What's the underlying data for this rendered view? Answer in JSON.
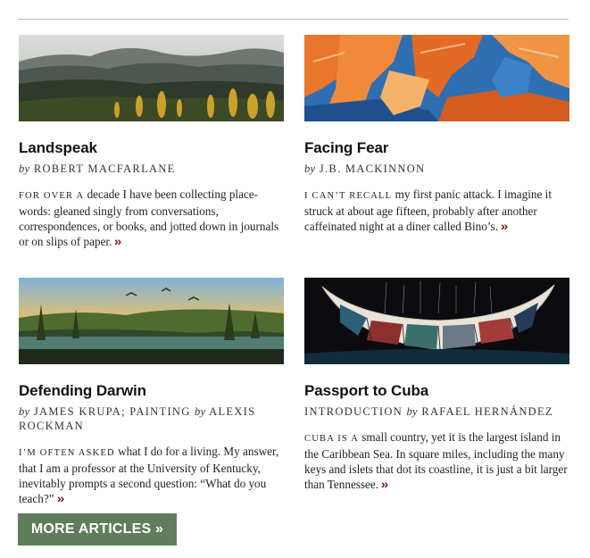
{
  "articles": [
    {
      "title": "Landspeak",
      "by_word": "by",
      "author": "ROBERT MACFARLANE",
      "lead": "FOR OVER A",
      "excerpt": " decade I have been collecting place-words: gleaned singly from conversations, correspondences, or books, and jotted down in journals or on slips of paper.",
      "more": "»",
      "image_icon": "mountain-landscape-photo"
    },
    {
      "title": "Facing Fear",
      "by_word": "by",
      "author": "J.B. MACKINNON",
      "lead": "I CAN’T RECALL",
      "excerpt": " my first panic attack. I imagine it struck at about age fifteen, probably after another caffeinated night at a diner called Bino’s.",
      "more": "»",
      "image_icon": "abstract-canyon-painting"
    },
    {
      "title": "Defending Darwin",
      "by_prefix": "",
      "by_word": "by",
      "author": "JAMES KRUPA; PAINTING",
      "by_word2": "by",
      "author2": "ALEXIS ROCKMAN",
      "lead": "I’M OFTEN ASKED",
      "excerpt": " what I do for a living. My answer, that I am a professor at the University of Kentucky, inevitably prompts a second question: “What do you teach?”",
      "more": "»",
      "image_icon": "prehistoric-swamp-painting"
    },
    {
      "title": "Passport to Cuba",
      "by_prefix": "INTRODUCTION",
      "by_word": "by",
      "author": "RAFAEL HERNÁNDEZ",
      "lead": "CUBA IS A",
      "excerpt": " small country, yet it is the largest island in the Caribbean Sea. In square miles, including the many keys and islets that dot its coastline, it is just a bit larger than Tennessee.",
      "more": "»",
      "image_icon": "stained-glass-boat-illustration"
    }
  ],
  "more_button": "MORE ARTICLES »",
  "colors": {
    "accent_arrow": "#7a1c12",
    "button_bg": "#5f7d5a",
    "rule": "#bdbdbd"
  }
}
